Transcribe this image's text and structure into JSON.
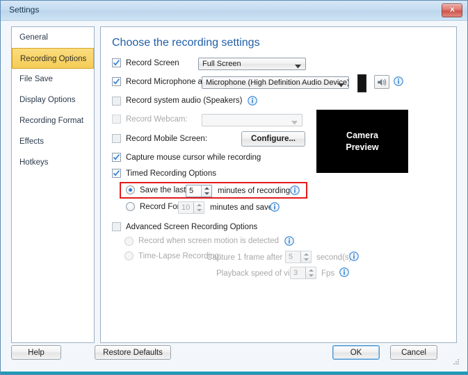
{
  "window": {
    "title": "Settings",
    "close_label": "Close",
    "close_icon": "close-icon"
  },
  "sidebar": {
    "items": [
      {
        "label": "General",
        "active": false
      },
      {
        "label": "Recording Options",
        "active": true
      },
      {
        "label": "File Save",
        "active": false
      },
      {
        "label": "Display Options",
        "active": false
      },
      {
        "label": "Recording Format",
        "active": false
      },
      {
        "label": "Effects",
        "active": false
      },
      {
        "label": "Hotkeys",
        "active": false
      }
    ],
    "highlight_color": "#f5cc57"
  },
  "main": {
    "heading": "Choose the recording settings",
    "heading_color": "#1f5fa8",
    "record_screen": {
      "label": "Record Screen",
      "checked": true,
      "combo_value": "Full Screen"
    },
    "record_microphone": {
      "label": "Record Microphone audio",
      "checked": true,
      "combo_value": "Microphone (High Definition Audio Device)",
      "meter_icon": "audio-level-meter",
      "speaker_icon": "speaker-icon",
      "info_icon": "info-icon"
    },
    "record_system_audio": {
      "label": "Record system audio (Speakers)",
      "checked": false,
      "info_icon": "info-icon"
    },
    "record_webcam": {
      "label": "Record Webcam:",
      "checked": false,
      "disabled": true,
      "combo_value": ""
    },
    "record_mobile_screen": {
      "label": "Record Mobile Screen:",
      "checked": false,
      "configure_label": "Configure..."
    },
    "capture_mouse_cursor": {
      "label": "Capture mouse cursor while recording",
      "checked": true
    },
    "timed_recording": {
      "label": "Timed Recording Options",
      "checked": true,
      "save_last": {
        "selected": true,
        "label": "Save the last",
        "value": "5",
        "suffix": "minutes of recordings",
        "info_icon": "info-icon"
      },
      "record_for": {
        "selected": false,
        "label": "Record For",
        "value": "10",
        "suffix": "minutes and save",
        "info_icon": "info-icon"
      },
      "highlight_color": "#e21b1b"
    },
    "advanced": {
      "label": "Advanced Screen Recording Options",
      "checked": false,
      "motion_detect": {
        "selected": false,
        "label": "Record when screen motion is detected",
        "info_icon": "info-icon"
      },
      "time_lapse": {
        "selected": false,
        "label": "Time-Lapse Recording:",
        "capture_label": "Capture 1 frame after every",
        "capture_value": "5",
        "capture_suffix": "second(s)",
        "playback_label": "Playback speed of video:",
        "playback_value": "3",
        "playback_suffix": "Fps",
        "info_icon": "info-icon"
      }
    },
    "camera_preview": {
      "line1": "Camera",
      "line2": "Preview"
    }
  },
  "footer": {
    "help": "Help",
    "restore_defaults": "Restore Defaults",
    "ok": "OK",
    "cancel": "Cancel"
  }
}
